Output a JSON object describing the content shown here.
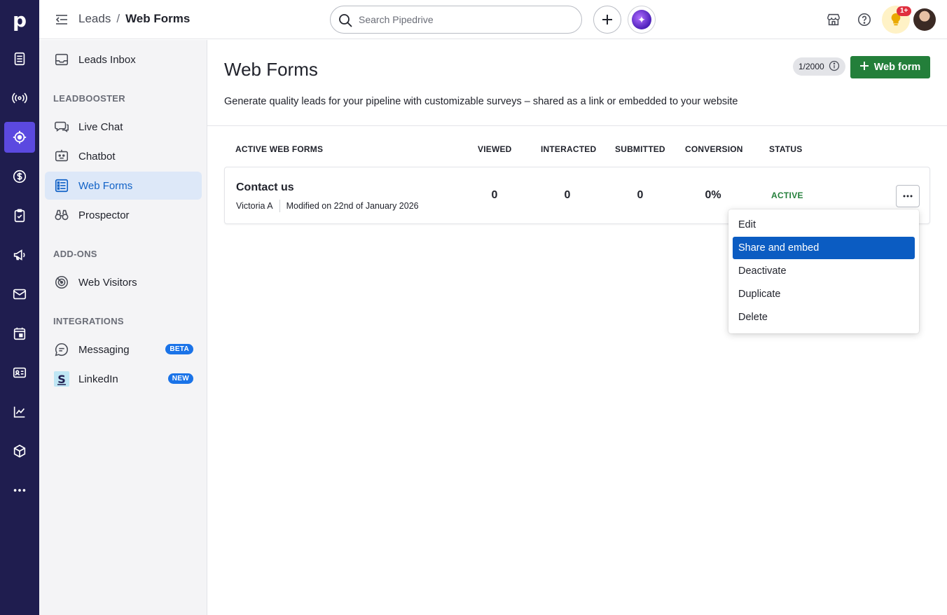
{
  "rail": {
    "logo": "p",
    "items": [
      "leads-icon",
      "broadcast-icon",
      "target-icon",
      "dollar-icon",
      "tasks-icon",
      "megaphone-icon",
      "mail-icon",
      "calendar-icon",
      "contacts-icon",
      "chart-icon",
      "box-icon",
      "more-icon"
    ],
    "active": "target-icon"
  },
  "topbar": {
    "breadcrumb": [
      "Leads",
      "/",
      "Web Forms"
    ],
    "search_placeholder": "Search Pipedrive",
    "notification_count": "1+"
  },
  "sidebar": {
    "inbox_label": "Leads Inbox",
    "sections": [
      {
        "heading": "LEADBOOSTER",
        "items": [
          {
            "label": "Live Chat",
            "icon": "chat-icon"
          },
          {
            "label": "Chatbot",
            "icon": "bot-icon"
          },
          {
            "label": "Web Forms",
            "icon": "form-icon",
            "active": true
          },
          {
            "label": "Prospector",
            "icon": "binoculars-icon"
          }
        ]
      },
      {
        "heading": "ADD-ONS",
        "items": [
          {
            "label": "Web Visitors",
            "icon": "radar-icon"
          }
        ]
      },
      {
        "heading": "INTEGRATIONS",
        "items": [
          {
            "label": "Messaging",
            "icon": "message-icon",
            "tag": "BETA"
          },
          {
            "label": "LinkedIn",
            "icon": "linkedin-icon",
            "tag": "NEW"
          }
        ]
      }
    ]
  },
  "main": {
    "title": "Web Forms",
    "description": "Generate quality leads for your pipeline with customizable surveys – shared as a link or embedded to your website",
    "quota": "1/2000",
    "new_button": "Web form",
    "columns": [
      "ACTIVE WEB FORMS",
      "VIEWED",
      "INTERACTED",
      "SUBMITTED",
      "CONVERSION",
      "STATUS"
    ],
    "rows": [
      {
        "name": "Contact us",
        "owner": "Victoria A",
        "modified": "Modified on 22nd of January 2026",
        "viewed": "0",
        "interacted": "0",
        "submitted": "0",
        "conversion": "0%",
        "status": "ACTIVE"
      }
    ],
    "menu": [
      "Edit",
      "Share and embed",
      "Deactivate",
      "Duplicate",
      "Delete"
    ],
    "menu_selected": "Share and embed"
  },
  "colors": {
    "rail_bg": "#1f1d4f",
    "rail_active": "#5b49e0",
    "primary_green": "#237f3a",
    "nav_active_text": "#1162c7",
    "menu_selected": "#0b5cc2"
  }
}
